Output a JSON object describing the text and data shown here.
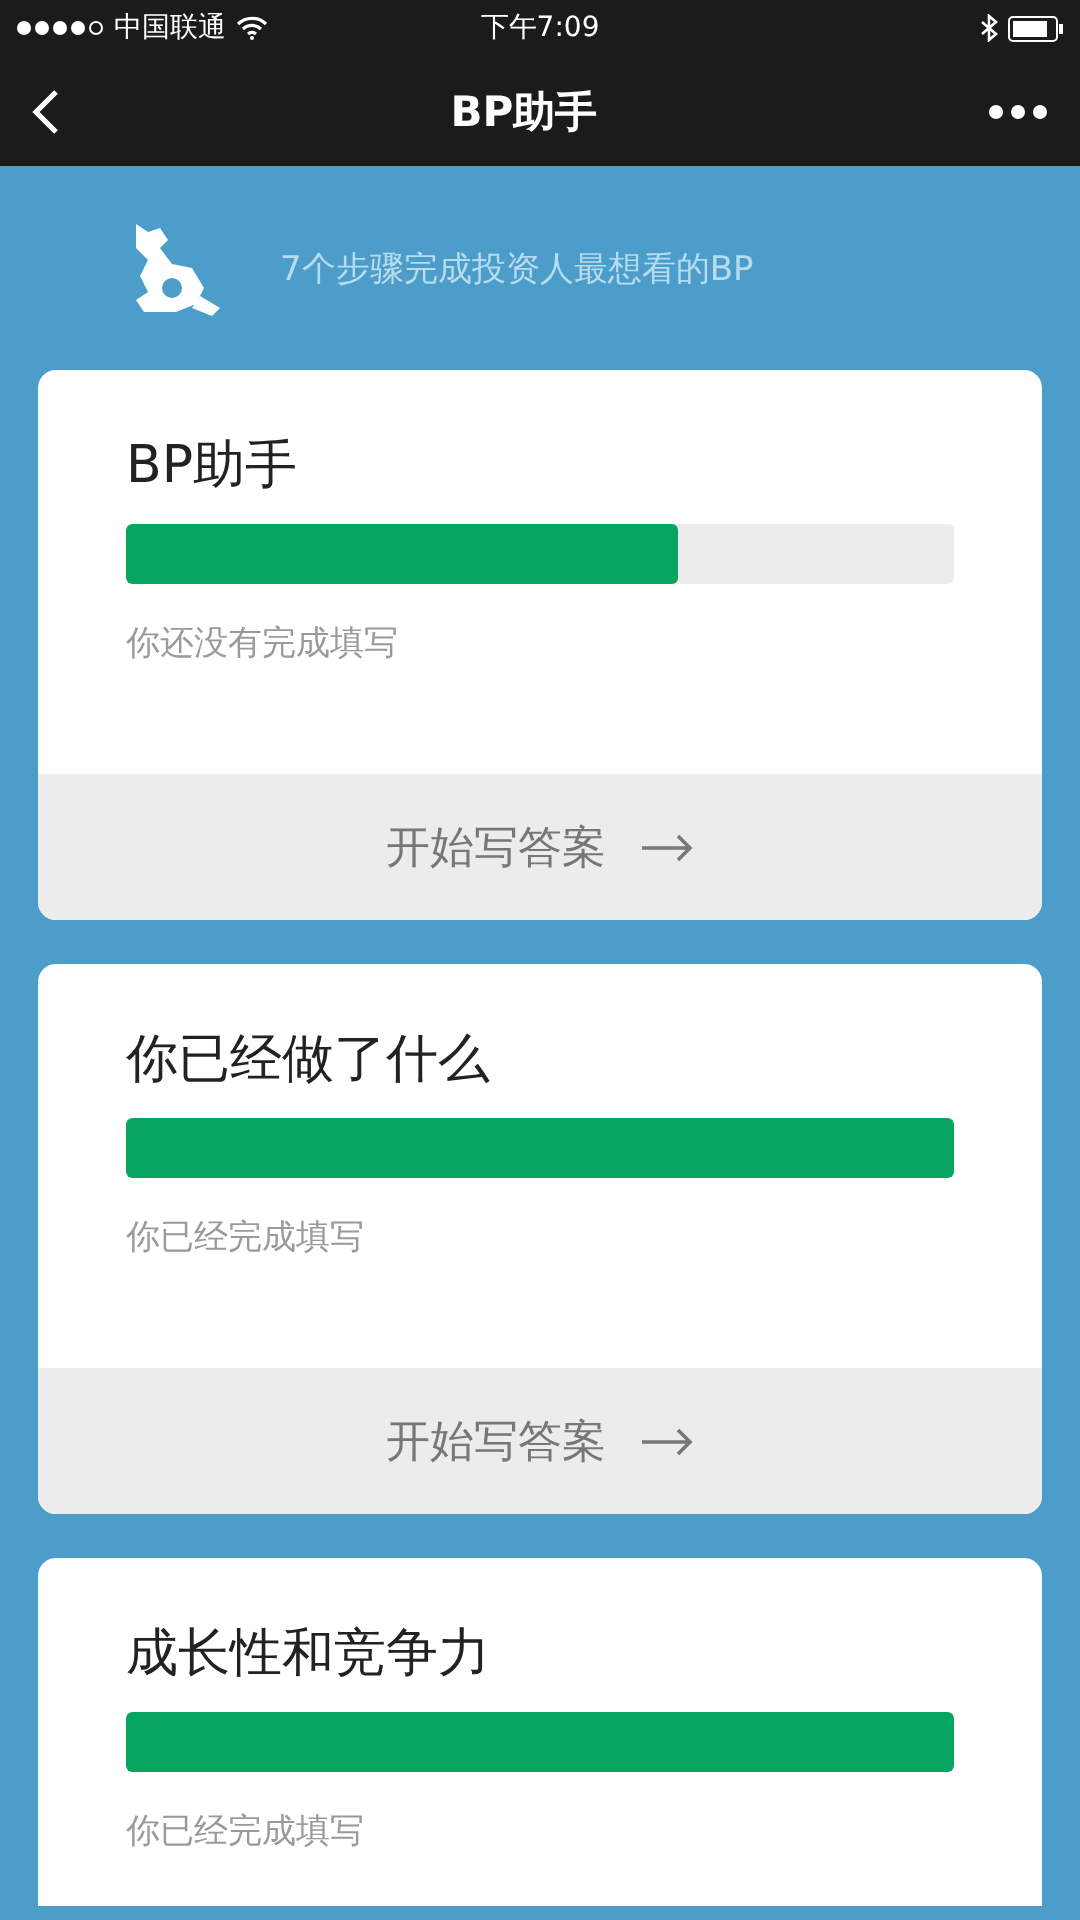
{
  "status_bar": {
    "carrier": "中国联通",
    "time": "下午7:09"
  },
  "nav": {
    "title": "BP助手"
  },
  "header": {
    "tagline": "7个步骤完成投资人最想看的BP"
  },
  "cards": [
    {
      "title": "BP助手",
      "level": 0.667,
      "status": "你还没有完成填写",
      "action": "开始写答案"
    },
    {
      "title": "你已经做了什么",
      "level": 1,
      "status": "你已经完成填写",
      "action": "开始写答案"
    },
    {
      "title": "成长性和竞争力",
      "level": 1,
      "status": "你已经完成填写"
    }
  ]
}
